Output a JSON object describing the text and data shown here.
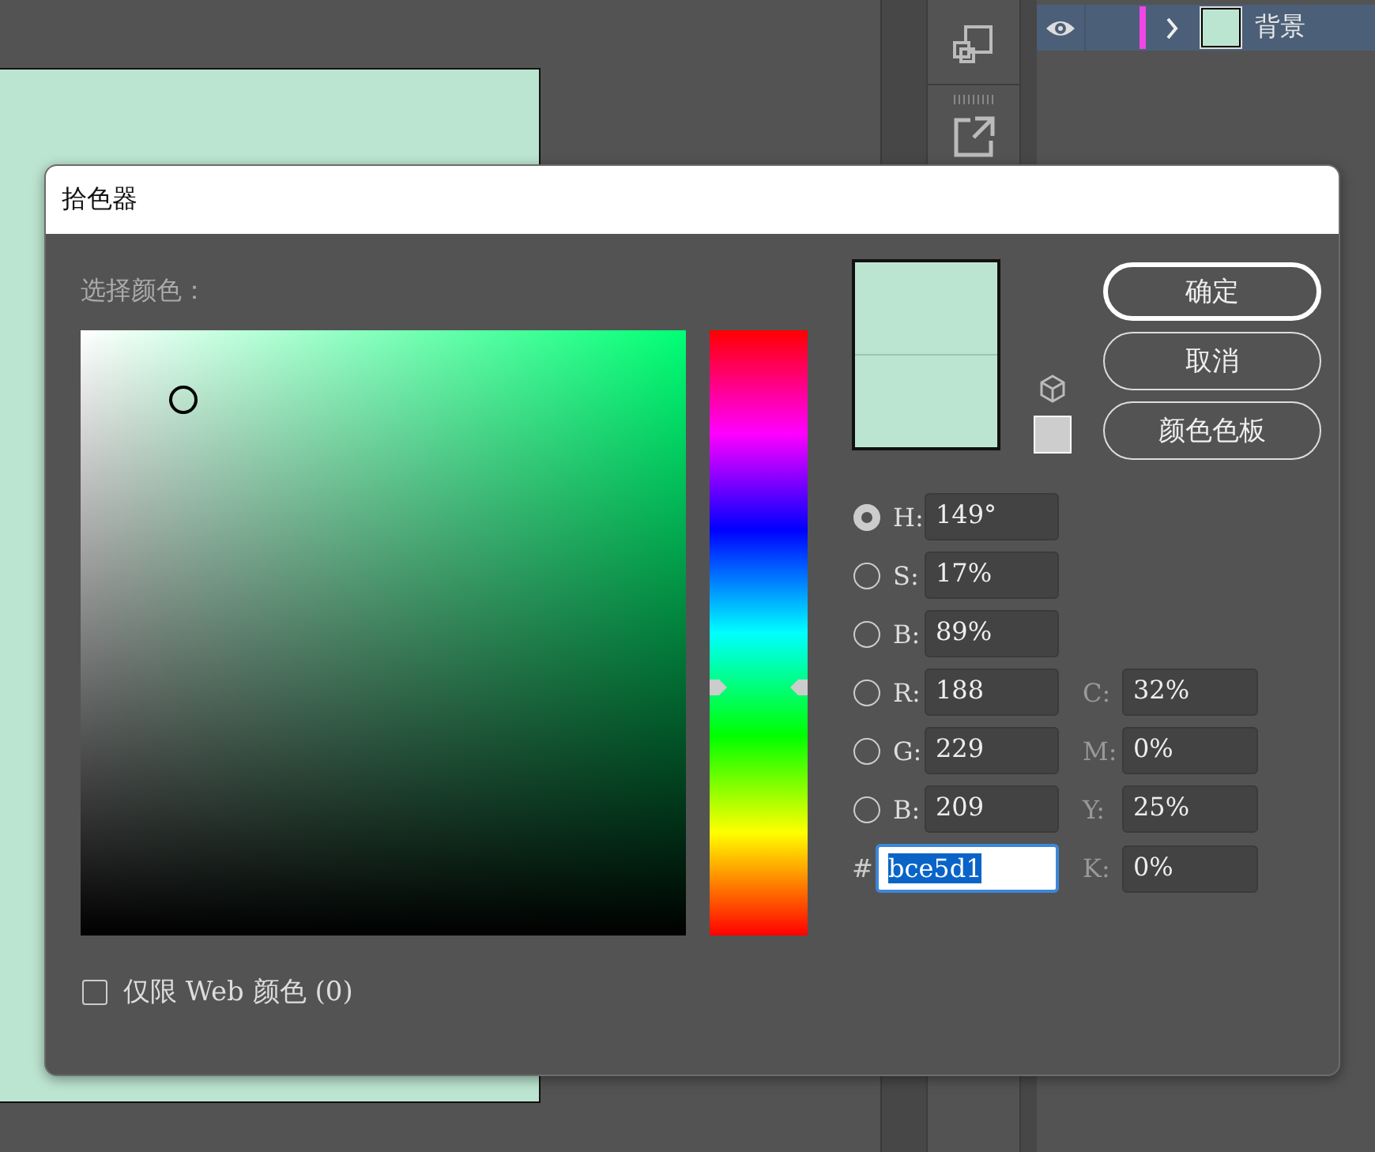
{
  "layers_panel": {
    "layers": [
      {
        "name": "背景",
        "visible": true,
        "expanded": false,
        "color": "#f046e6"
      }
    ]
  },
  "dialog": {
    "title": "拾色器",
    "prompt": "选择颜色：",
    "hue_slider": {
      "level": 0.41
    },
    "preview": [
      {
        "kind": "new",
        "color": "#bce5d1"
      },
      {
        "kind": "current",
        "color": "#bce5d1"
      }
    ],
    "buttons": [
      {
        "label": "确定",
        "default": true
      },
      {
        "label": "取消",
        "default": false
      },
      {
        "label": "颜色色板",
        "default": false
      }
    ],
    "model_fields": [
      {
        "label": "H:",
        "value": "149°",
        "selected": true
      },
      {
        "label": "S:",
        "value": "17%",
        "selected": false
      },
      {
        "label": "B:",
        "value": "89%",
        "selected": false
      },
      {
        "label": "R:",
        "value": "188",
        "selected": false
      },
      {
        "label": "G:",
        "value": "229",
        "selected": false
      },
      {
        "label": "B:",
        "value": "209",
        "selected": false
      }
    ],
    "cmyk_fields": [
      {
        "label": "C:",
        "value": "32%"
      },
      {
        "label": "M:",
        "value": "0%"
      },
      {
        "label": "Y:",
        "value": "25%"
      },
      {
        "label": "K:",
        "value": "0%"
      }
    ],
    "hex_field": {
      "label": "#",
      "value": "bce5d1",
      "text_selected": true
    },
    "web_only": {
      "label": "仅限 Web 颜色 (0)",
      "checked": false
    }
  }
}
